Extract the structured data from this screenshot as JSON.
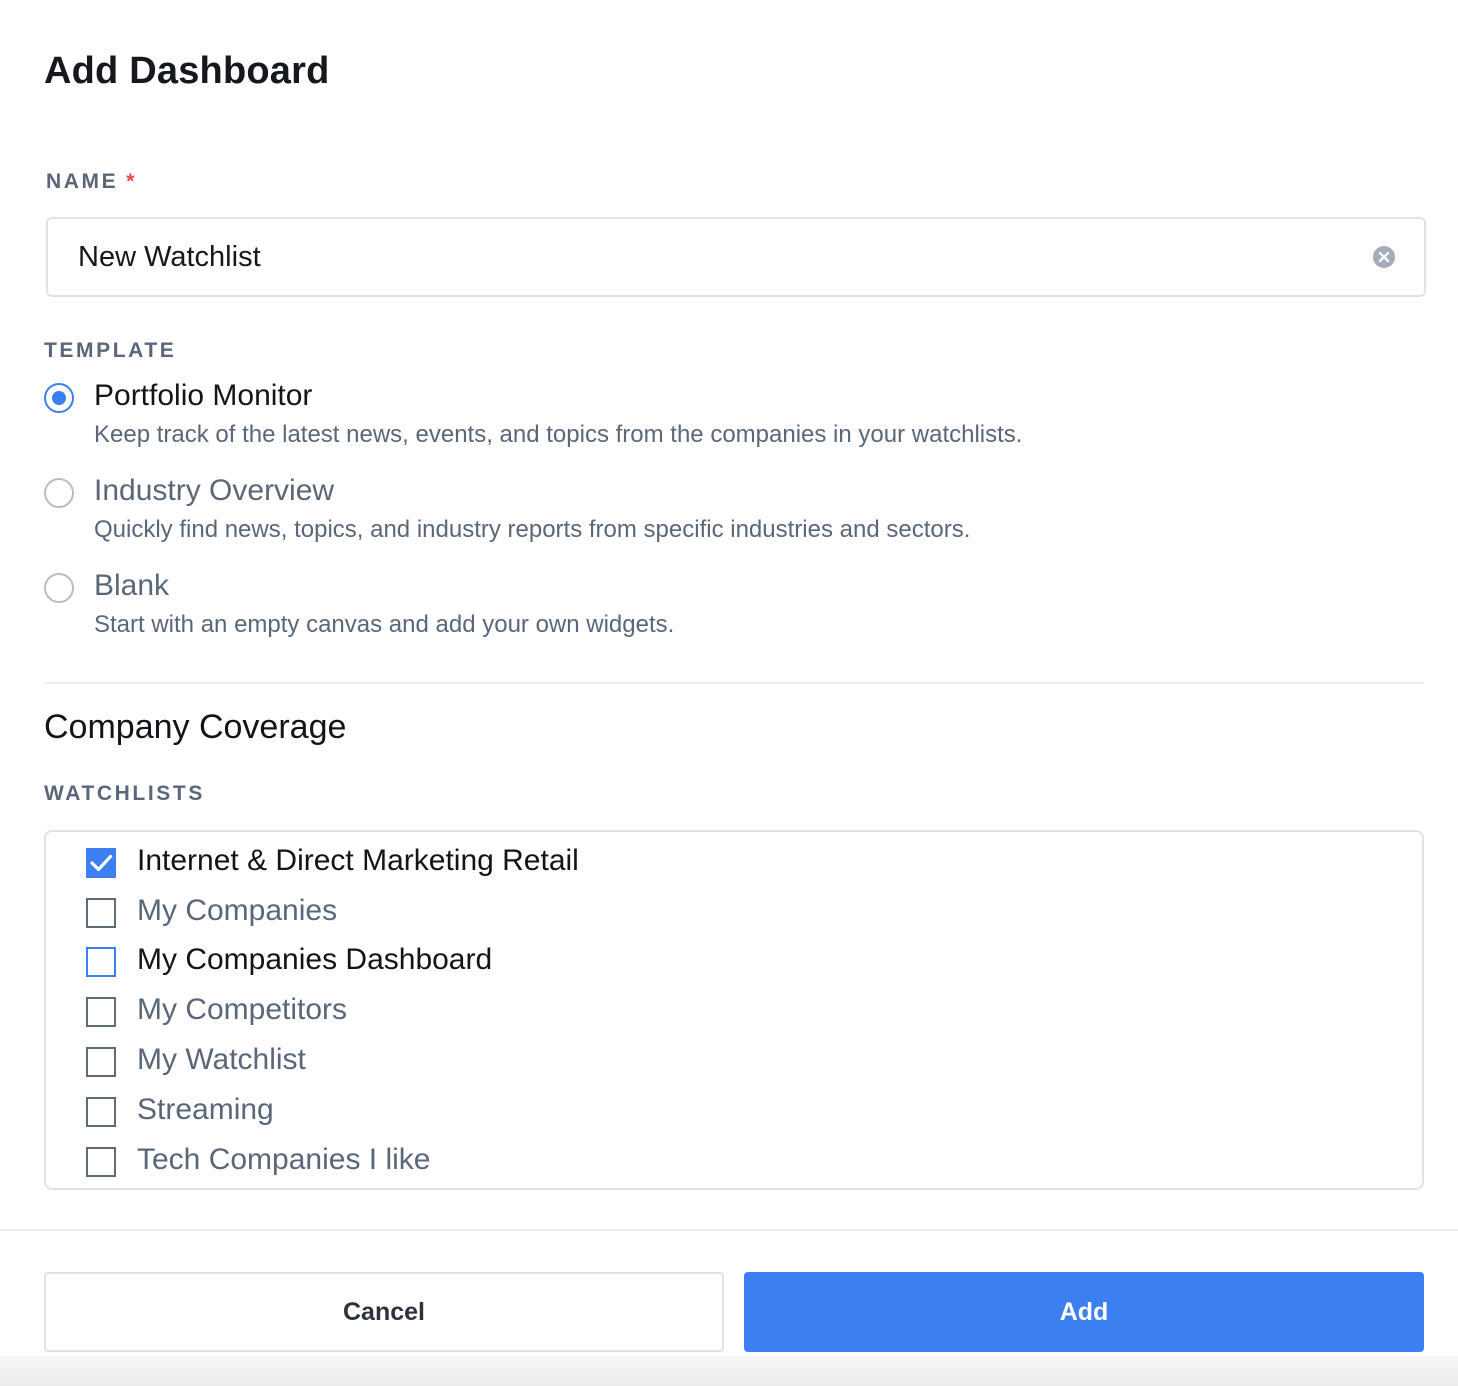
{
  "dialog": {
    "title": "Add Dashboard"
  },
  "name_field": {
    "label": "NAME",
    "required_marker": "*",
    "value": "New Watchlist"
  },
  "template": {
    "label": "TEMPLATE",
    "options": [
      {
        "title": "Portfolio Monitor",
        "description": "Keep track of the latest news, events, and topics from the companies in your watchlists.",
        "selected": true
      },
      {
        "title": "Industry Overview",
        "description": "Quickly find news, topics, and industry reports from specific industries and sectors.",
        "selected": false
      },
      {
        "title": "Blank",
        "description": "Start with an empty canvas and add your own widgets.",
        "selected": false
      }
    ]
  },
  "coverage": {
    "title": "Company Coverage",
    "watchlists_label": "WATCHLISTS",
    "watchlists": [
      {
        "label": "Internet & Direct Marketing Retail",
        "checked": true
      },
      {
        "label": "My Companies",
        "checked": false
      },
      {
        "label": "My Companies Dashboard",
        "checked": false,
        "hover": true
      },
      {
        "label": "My Competitors",
        "checked": false
      },
      {
        "label": "My Watchlist",
        "checked": false
      },
      {
        "label": "Streaming",
        "checked": false
      },
      {
        "label": "Tech Companies I like",
        "checked": false
      }
    ]
  },
  "footer": {
    "cancel_label": "Cancel",
    "add_label": "Add"
  },
  "colors": {
    "accent": "#3b7ff1",
    "required": "#e5484d",
    "muted_text": "#5a6779"
  },
  "icons": {
    "clear": "clear-icon",
    "check": "checkmark-icon"
  }
}
